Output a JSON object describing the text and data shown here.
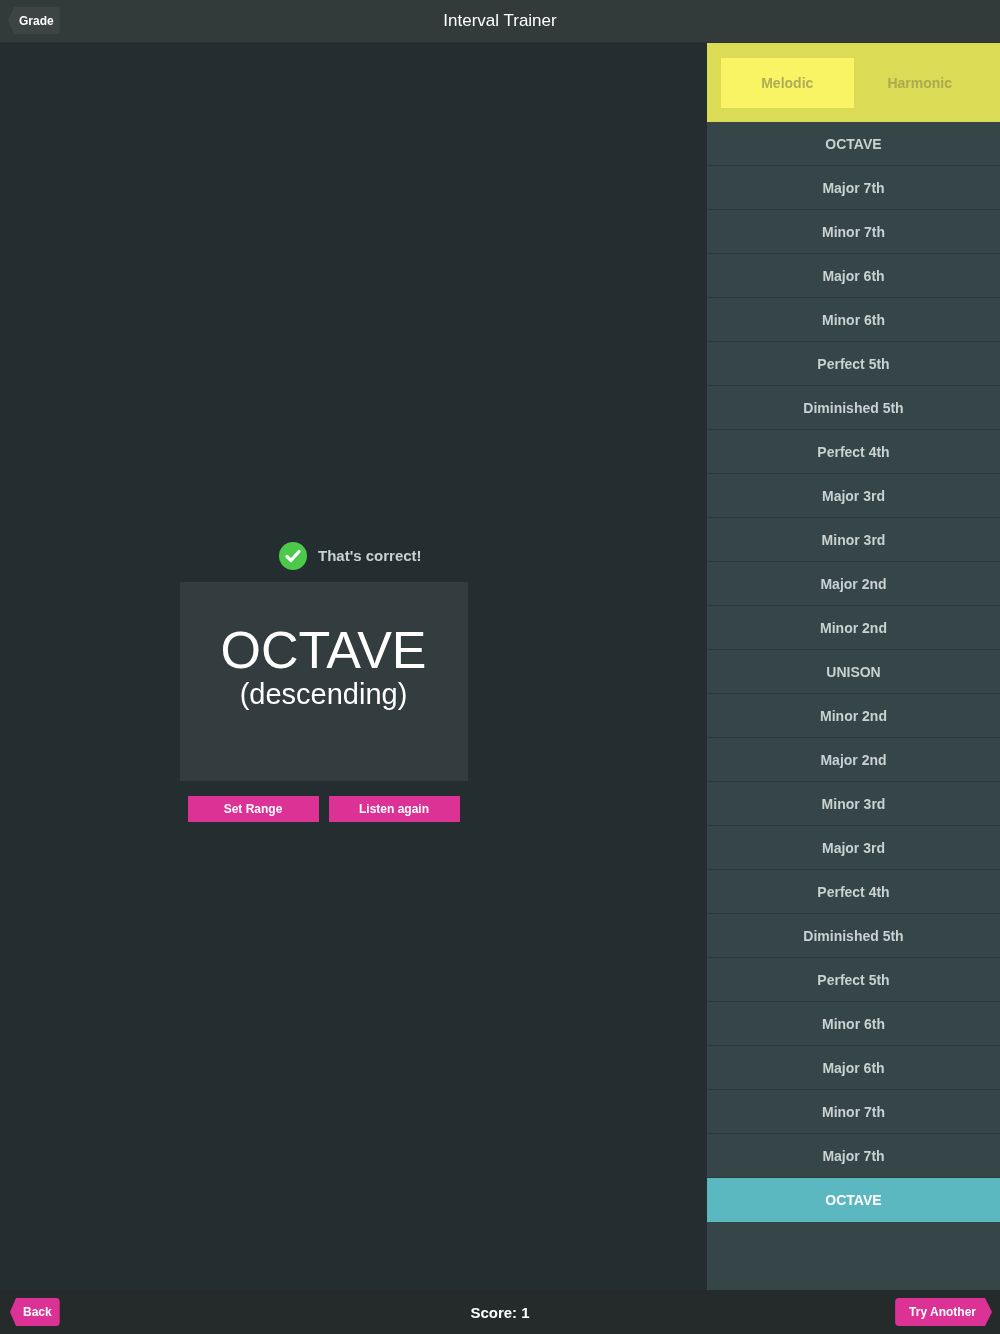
{
  "navbar": {
    "back_button": "Grade",
    "title": "Interval Trainer"
  },
  "feedback": {
    "correct": true,
    "message": "That's correct!"
  },
  "answer": {
    "interval": "OCTAVE",
    "direction": "(descending)"
  },
  "buttons": [
    "Set Range",
    "Listen again"
  ],
  "tabs": [
    {
      "label": "Melodic",
      "selected": true
    },
    {
      "label": "Harmonic",
      "selected": false
    }
  ],
  "intervals": [
    {
      "label": "OCTAVE",
      "selected": false
    },
    {
      "label": "Major 7th",
      "selected": false
    },
    {
      "label": "Minor 7th",
      "selected": false
    },
    {
      "label": "Major 6th",
      "selected": false
    },
    {
      "label": "Minor 6th",
      "selected": false
    },
    {
      "label": "Perfect 5th",
      "selected": false
    },
    {
      "label": "Diminished 5th",
      "selected": false
    },
    {
      "label": "Perfect 4th",
      "selected": false
    },
    {
      "label": "Major 3rd",
      "selected": false
    },
    {
      "label": "Minor 3rd",
      "selected": false
    },
    {
      "label": "Major 2nd",
      "selected": false
    },
    {
      "label": "Minor 2nd",
      "selected": false
    },
    {
      "label": "UNISON",
      "selected": false
    },
    {
      "label": "Minor 2nd",
      "selected": false
    },
    {
      "label": "Major 2nd",
      "selected": false
    },
    {
      "label": "Minor 3rd",
      "selected": false
    },
    {
      "label": "Major 3rd",
      "selected": false
    },
    {
      "label": "Perfect 4th",
      "selected": false
    },
    {
      "label": "Diminished 5th",
      "selected": false
    },
    {
      "label": "Perfect 5th",
      "selected": false
    },
    {
      "label": "Minor 6th",
      "selected": false
    },
    {
      "label": "Major 6th",
      "selected": false
    },
    {
      "label": "Minor 7th",
      "selected": false
    },
    {
      "label": "Major 7th",
      "selected": false
    },
    {
      "label": "OCTAVE",
      "selected": true
    }
  ],
  "footer": {
    "back_button": "Back",
    "score": "Score: 1",
    "next_button": "Try Another"
  }
}
